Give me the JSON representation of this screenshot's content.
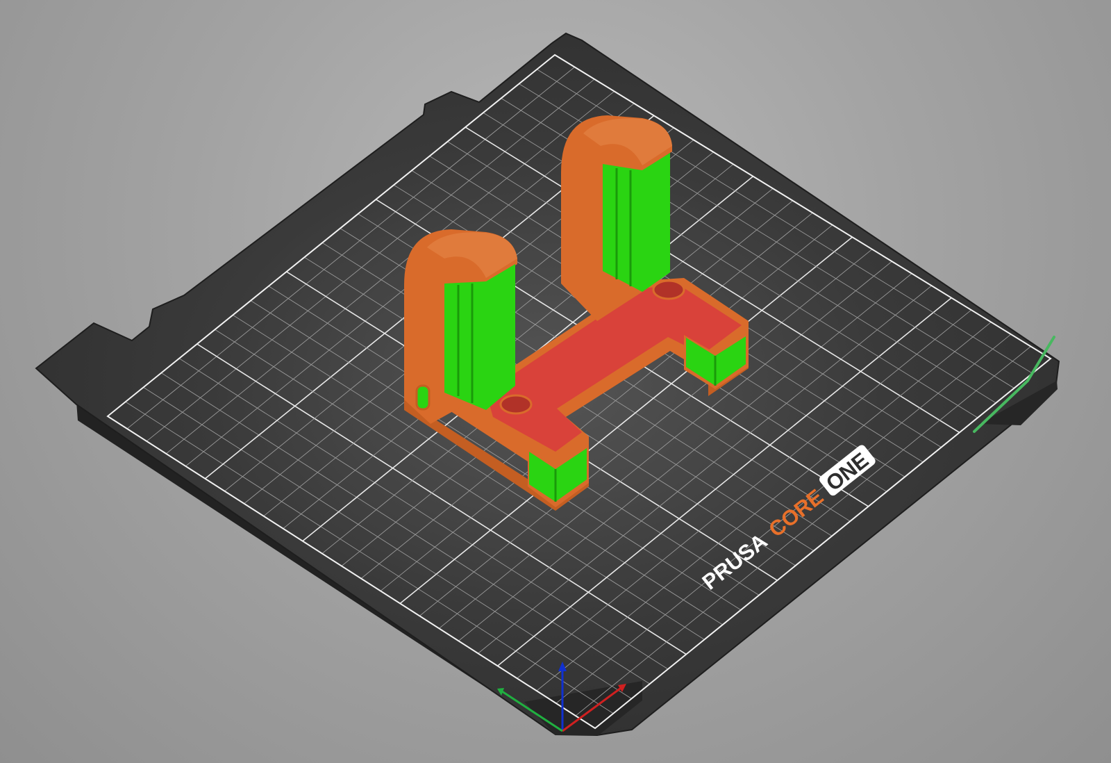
{
  "bed": {
    "brand": "PRUSA",
    "model_core": "CORE",
    "model_one": "ONE"
  },
  "colors": {
    "background": "#a6a6a6",
    "bed_sheet": "#2e2e2e",
    "grid_line": "#ffffff",
    "perimeter": "#d96b2b",
    "solid_infill": "#2ad412",
    "top_infill": "#d9423a",
    "axis_x": "#d02020",
    "axis_y": "#20b040",
    "axis_z": "#1030d0",
    "logo_orange": "#e8702a",
    "logo_white": "#ffffff"
  },
  "icons": {
    "axes": "xyz-axes-icon",
    "bed": "print-bed-icon"
  }
}
